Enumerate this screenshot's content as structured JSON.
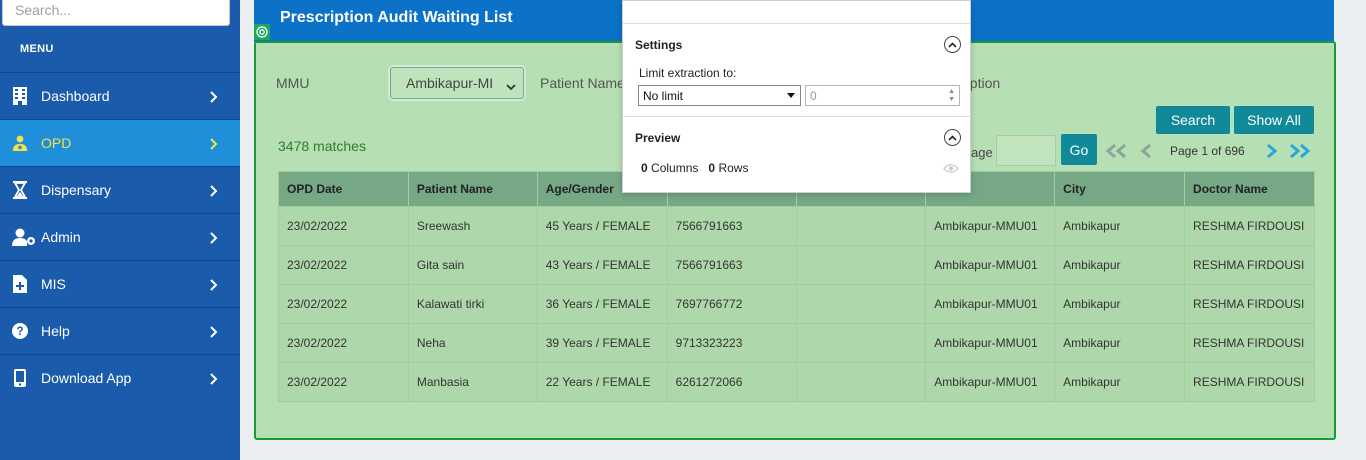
{
  "sidebar": {
    "search_placeholder": "Search...",
    "menu_heading": "MENU",
    "items": [
      {
        "label": "Dashboard",
        "icon": "building-icon"
      },
      {
        "label": "OPD",
        "icon": "doctor-icon"
      },
      {
        "label": "Dispensary",
        "icon": "hourglass-icon"
      },
      {
        "label": "Admin",
        "icon": "user-cog-icon"
      },
      {
        "label": "MIS",
        "icon": "file-plus-icon"
      },
      {
        "label": "Help",
        "icon": "question-circle-icon"
      },
      {
        "label": "Download App",
        "icon": "mobile-icon"
      }
    ],
    "active_index": 1
  },
  "header": {
    "title": "Prescription Audit Waiting List"
  },
  "filters": {
    "mmu_label": "MMU",
    "mmu_value": "Ambikapur-MI",
    "patient_name_label": "Patient Name",
    "reception_label_partial": "eption"
  },
  "results": {
    "matches": "3478 matches"
  },
  "buttons": {
    "search": "Search",
    "show_all": "Show All",
    "go": "Go"
  },
  "pagination": {
    "page_label_partial": "age",
    "page_text": "Page 1 of 696",
    "current_page": 1,
    "total_pages": 696
  },
  "table": {
    "headers": [
      "OPD Date",
      "Patient Name",
      "Age/Gender",
      "",
      "",
      "",
      "City",
      "Doctor Name"
    ],
    "rows": [
      [
        "23/02/2022",
        "Sreewash",
        "45 Years / FEMALE",
        "7566791663",
        "",
        "Ambikapur-MMU01",
        "Ambikapur",
        "RESHMA FIRDOUSI"
      ],
      [
        "23/02/2022",
        "Gita sain",
        "43 Years / FEMALE",
        "7566791663",
        "",
        "Ambikapur-MMU01",
        "Ambikapur",
        "RESHMA FIRDOUSI"
      ],
      [
        "23/02/2022",
        "Kalawati tirki",
        "36 Years / FEMALE",
        "7697766772",
        "",
        "Ambikapur-MMU01",
        "Ambikapur",
        "RESHMA FIRDOUSI"
      ],
      [
        "23/02/2022",
        "Neha",
        "39 Years / FEMALE",
        "9713323223",
        "",
        "Ambikapur-MMU01",
        "Ambikapur",
        "RESHMA FIRDOUSI"
      ],
      [
        "23/02/2022",
        "Manbasia",
        "22 Years / FEMALE",
        "6261272066",
        "",
        "Ambikapur-MMU01",
        "Ambikapur",
        "RESHMA FIRDOUSI"
      ]
    ]
  },
  "popup": {
    "settings_title": "Settings",
    "limit_label": "Limit extraction to:",
    "limit_value": "No limit",
    "limit_number": "0",
    "preview_title": "Preview",
    "columns_count": "0",
    "columns_label": "Columns",
    "rows_count": "0",
    "rows_label": "Rows"
  },
  "colors": {
    "sidebar_bg": "#1a5bab",
    "sidebar_active": "#1e8fd8",
    "active_label": "#f4e04a",
    "header_bg": "#0b72c8",
    "panel_bg": "#b6dfb4",
    "panel_border": "#1a9a3a",
    "button_teal": "#108a98",
    "matches_text": "#2e7d32"
  }
}
